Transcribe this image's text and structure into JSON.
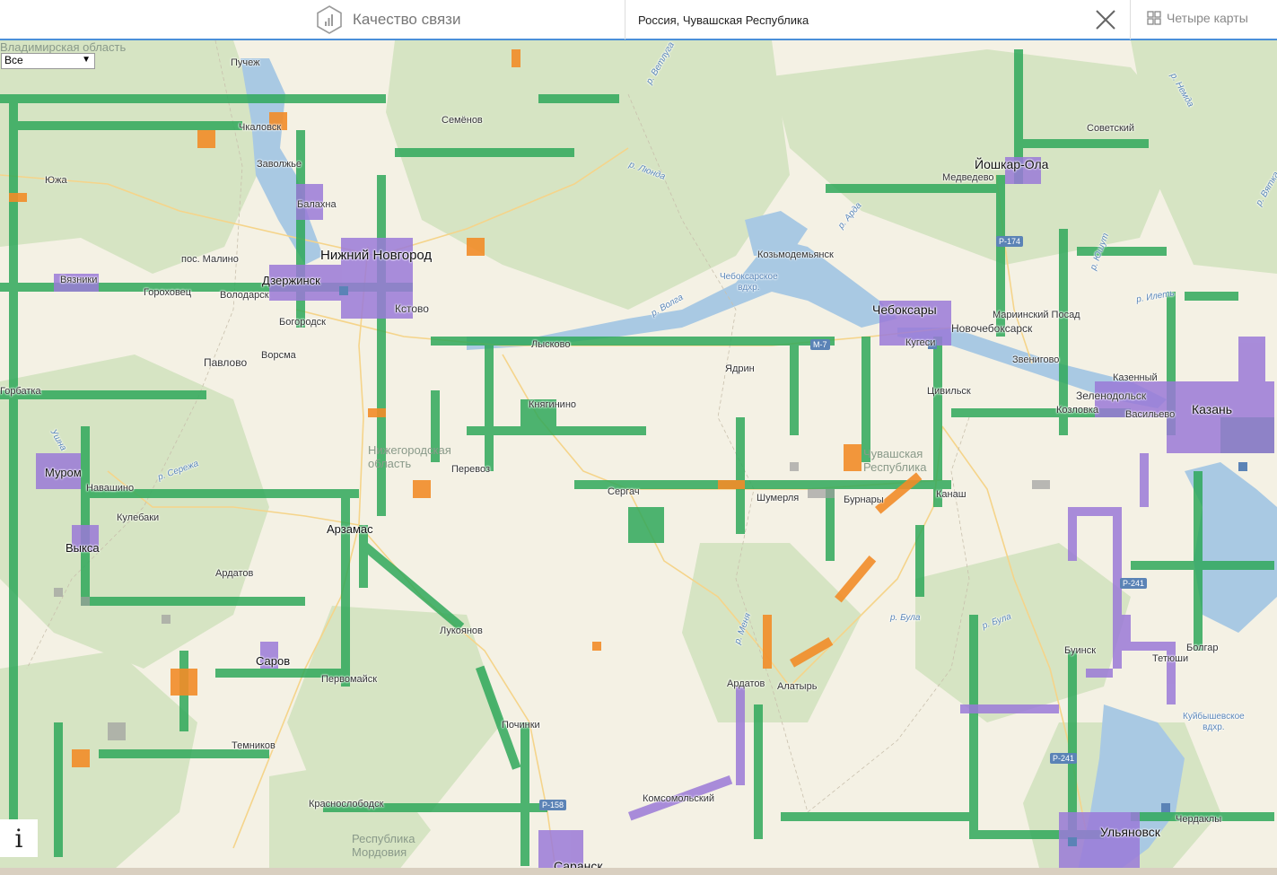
{
  "header": {
    "title": "Качество связи",
    "search_value": "Россия, Чувашская Республика",
    "four_maps_label": "Четыре карты"
  },
  "filter": {
    "selected": "Все"
  },
  "info_label": "i",
  "legend_colors": {
    "good": "#2fa85a",
    "medium": "#f28c28",
    "lte": "#9a7ad8",
    "no_data": "#9e9e9e",
    "water": "#a9c9e3",
    "forest": "#d8e6c4"
  },
  "map_labels": {
    "cities": {
      "nizhny": "Нижний Новгород",
      "cheboksary": "Чебоксары",
      "yoshkar": "Йошкар-Ола",
      "kazan": "Казань",
      "ulyanovsk": "Ульяновск",
      "dzerzhinsk": "Дзержинск",
      "arzamas": "Арзамас",
      "murom": "Муром",
      "vyksa": "Выкса",
      "sarov": "Саров",
      "saransk": "Саранск",
      "novocheb": "Новочебоксарск"
    },
    "towns": {
      "puchezh": "Пучеж",
      "chkalovsk": "Чкаловск",
      "zavolzhye": "Заволжье",
      "balakhna": "Балахна",
      "semenov": "Семёнов",
      "yuzha": "Южа",
      "malino": "пос. Малино",
      "vyazniki": "Вязники",
      "gorokhovets": "Гороховец",
      "volodarsk": "Володарск",
      "bogorodsk": "Богородск",
      "kstovo": "Кстово",
      "lyskovo": "Лысково",
      "pavlovo": "Павлово",
      "vorsma": "Ворсма",
      "gorbatka": "Горбатка",
      "knyaginino": "Княгинино",
      "perevoz": "Перевоз",
      "sergach": "Сергач",
      "navashino": "Навашино",
      "kulebaki": "Кулебаки",
      "ardatov1": "Ардатов",
      "lukoyanov": "Лукоянов",
      "pervomaysk": "Первомайск",
      "pochinki": "Починки",
      "temnikov": "Темников",
      "krasnoslobodsk": "Краснослободск",
      "komsomolsky": "Комсомольский",
      "ardatov2": "Ардатов",
      "alatyr": "Алатырь",
      "shumerlya": "Шумерля",
      "yadrin": "Ядрин",
      "buinsk_ch": "Буинск",
      "burnary": "Бурнары",
      "kanash": "Канаш",
      "tsivilsk": "Цивильск",
      "kozmodemyansk": "Козьмодемьянск",
      "medvedevo": "Медведево",
      "sovetsky": "Советский",
      "mariinsky": "Мариинский Посад",
      "zvenigovo": "Звенигово",
      "kazinsky": "Казенный",
      "zelenodolsk": "Зеленодольск",
      "kozlovka": "Козловка",
      "vasilyevo": "Васильево",
      "tetyushi": "Тетюши",
      "bolgar": "Болгар",
      "chardakly": "Чердаклы",
      "kuteyev": "Кугеси"
    },
    "regions": {
      "nizh_oblast": "Нижегородская\nобласть",
      "chuvash": "Чувашская\nРеспублика",
      "mordovia": "Республика\nМордовия",
      "vladim": "Владимирская область"
    },
    "rivers": {
      "volga1": "р. Волга",
      "lunda": "р. Люнда",
      "vetluga": "р. Ветлуга",
      "seregha": "р. Сережа",
      "ushna": "Ушна",
      "bula1": "р. Була",
      "bula2": "р. Була",
      "menya": "р. Меня",
      "ardu": "р. Арда",
      "ilet": "р. Илеть",
      "yushut": "р. Юшут",
      "nemda": "р. Немда",
      "vyatka": "р. Вятка"
    },
    "reservoirs": {
      "cheb": "Чебоксарское\nвдхр.",
      "kuib": "Куйбышевское\nвдхр."
    },
    "roads": {
      "m7": "М-7",
      "p174": "Р-174",
      "p241a": "Р-241",
      "p241b": "Р-241",
      "p158": "Р-158"
    }
  }
}
